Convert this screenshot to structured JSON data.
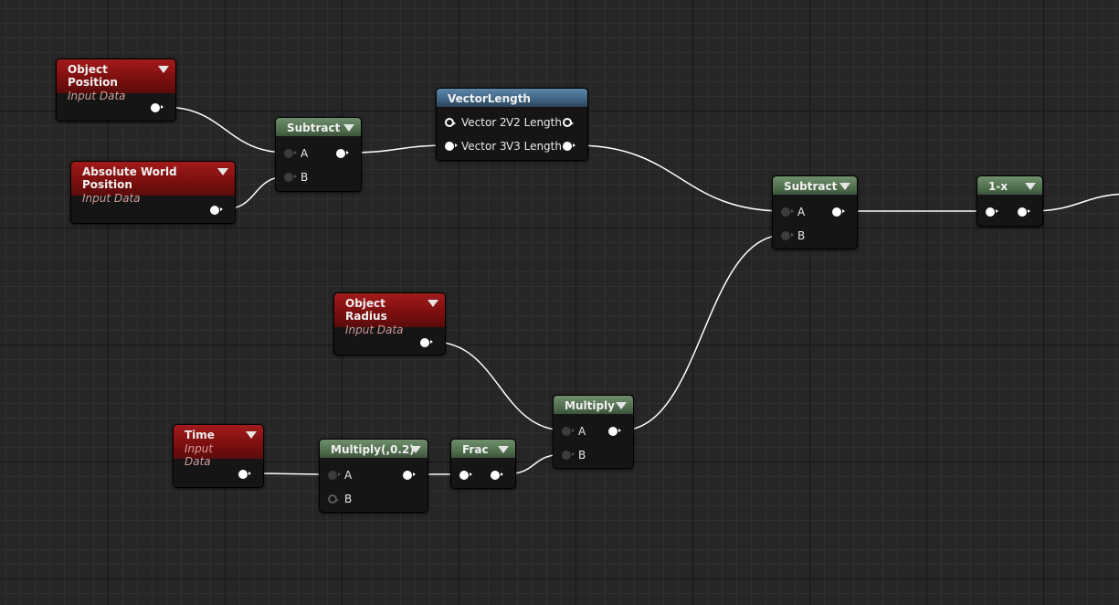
{
  "nodes": [
    {
      "id": "object-position",
      "title": "Object Position",
      "subtitle": "Input Data",
      "color": "red",
      "inputs": [],
      "outputs": [
        {
          "label": "",
          "state": "on"
        }
      ]
    },
    {
      "id": "absolute-world-position",
      "title": "Absolute World Position",
      "subtitle": "Input Data",
      "color": "red",
      "inputs": [],
      "outputs": [
        {
          "label": "",
          "state": "on"
        }
      ]
    },
    {
      "id": "subtract-1",
      "title": "Subtract",
      "color": "green",
      "inputs": [
        {
          "label": "A",
          "state": "off"
        },
        {
          "label": "B",
          "state": "off"
        }
      ],
      "outputs": [
        {
          "label": "",
          "state": "on"
        }
      ]
    },
    {
      "id": "vector-length",
      "title": "VectorLength",
      "color": "blue",
      "nochev": true,
      "inputs": [
        {
          "label": "Vector 2",
          "state": "ring"
        },
        {
          "label": "Vector 3",
          "state": "on"
        }
      ],
      "outputs": [
        {
          "label": "V2 Length",
          "state": "ring"
        },
        {
          "label": "V3 Length",
          "state": "on"
        }
      ]
    },
    {
      "id": "subtract-2",
      "title": "Subtract",
      "color": "green",
      "inputs": [
        {
          "label": "A",
          "state": "off"
        },
        {
          "label": "B",
          "state": "off"
        }
      ],
      "outputs": [
        {
          "label": "",
          "state": "on"
        }
      ]
    },
    {
      "id": "one-minus-x",
      "title": "1-x",
      "color": "green",
      "inputs": [
        {
          "label": "",
          "state": "on"
        }
      ],
      "outputs": [
        {
          "label": "",
          "state": "on"
        }
      ]
    },
    {
      "id": "object-radius",
      "title": "Object Radius",
      "subtitle": "Input Data",
      "color": "red",
      "inputs": [],
      "outputs": [
        {
          "label": "",
          "state": "on"
        }
      ]
    },
    {
      "id": "multiply",
      "title": "Multiply",
      "color": "green",
      "inputs": [
        {
          "label": "A",
          "state": "off"
        },
        {
          "label": "B",
          "state": "off"
        }
      ],
      "outputs": [
        {
          "label": "",
          "state": "on"
        }
      ]
    },
    {
      "id": "time",
      "title": "Time",
      "subtitle": "Input Data",
      "color": "red",
      "inputs": [],
      "outputs": [
        {
          "label": "",
          "state": "on"
        }
      ]
    },
    {
      "id": "multiply-02",
      "title": "Multiply(,0.2)",
      "color": "green",
      "inputs": [
        {
          "label": "A",
          "state": "off"
        },
        {
          "label": "B",
          "state": "ringd"
        }
      ],
      "outputs": [
        {
          "label": "",
          "state": "on"
        }
      ]
    },
    {
      "id": "frac",
      "title": "Frac",
      "color": "green",
      "inputs": [
        {
          "label": "",
          "state": "on"
        }
      ],
      "outputs": [
        {
          "label": "",
          "state": "on"
        }
      ]
    }
  ],
  "connections": [
    [
      "object-position.out0",
      "subtract-1.in0"
    ],
    [
      "absolute-world-position.out0",
      "subtract-1.in1"
    ],
    [
      "subtract-1.out0",
      "vector-length.in1"
    ],
    [
      "vector-length.out1",
      "subtract-2.in0"
    ],
    [
      "subtract-2.out0",
      "one-minus-x.in0"
    ],
    [
      "one-minus-x.out0",
      "offscreen"
    ],
    [
      "object-radius.out0",
      "multiply.in0"
    ],
    [
      "time.out0",
      "multiply-02.in0"
    ],
    [
      "multiply-02.out0",
      "frac.in0"
    ],
    [
      "frac.out0",
      "multiply.in1"
    ],
    [
      "multiply.out0",
      "subtract-2.in1"
    ]
  ],
  "colors": {
    "input_data": "#a31b1b",
    "math": "#5d7a5a",
    "utility": "#4f7596",
    "wire": "#ffffff"
  }
}
